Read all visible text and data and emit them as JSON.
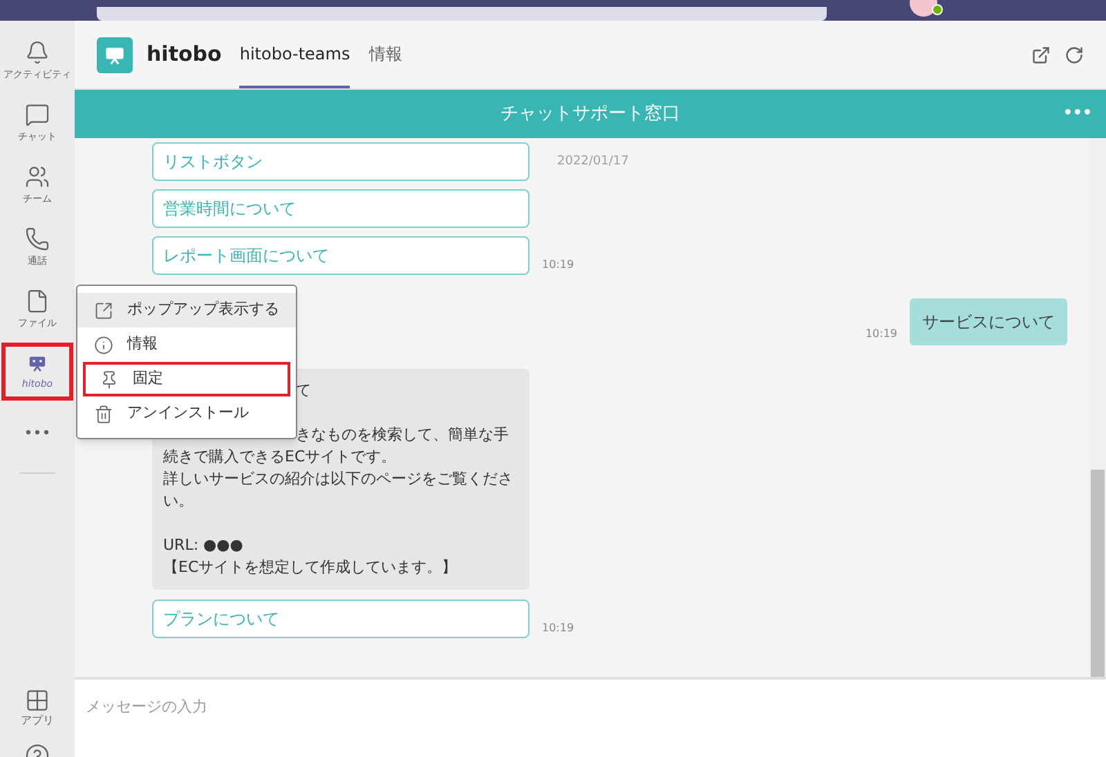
{
  "rail": {
    "items": [
      {
        "kind": "bell",
        "label": "アクティビティ",
        "selected": false,
        "highlighted": false
      },
      {
        "kind": "chat",
        "label": "チャット",
        "selected": false,
        "highlighted": false
      },
      {
        "kind": "team",
        "label": "チーム",
        "selected": false,
        "highlighted": false
      },
      {
        "kind": "call",
        "label": "通話",
        "selected": false,
        "highlighted": false
      },
      {
        "kind": "file",
        "label": "ファイル",
        "selected": false,
        "highlighted": false
      },
      {
        "kind": "bot",
        "label": "hitobo",
        "selected": true,
        "highlighted": true
      },
      {
        "kind": "more",
        "label": "•••",
        "selected": false,
        "highlighted": false
      }
    ],
    "bottom": [
      {
        "kind": "apps",
        "label": "アプリ"
      },
      {
        "kind": "help"
      }
    ]
  },
  "app_header": {
    "name": "hitobo",
    "tabs": [
      {
        "label": "hitobo-teams",
        "selected": true
      },
      {
        "label": "情報",
        "selected": false
      }
    ]
  },
  "chat_bar": {
    "title": "チャットサポート窓口",
    "more": "•••"
  },
  "messages": [
    {
      "kind": "buttons",
      "buttons": [
        "リストボタン",
        "営業時間について",
        "レポート画面について"
      ],
      "date": "2022/01/17",
      "time": "10:19"
    },
    {
      "kind": "user",
      "text": "サービスについて",
      "time": "10:19"
    },
    {
      "kind": "bot",
      "lines": [
        {
          "text": "て",
          "hidden_start": true
        },
        {
          "text": "きなものを検索して、簡単な手",
          "hidden_start": true
        },
        {
          "text": "続きで購入できるECサイトです。",
          "hidden_start": false
        },
        {
          "text": "詳しいサービスの紹介は以下のページをご覧ください。",
          "hidden_start": false
        },
        {
          "text": "URL: ●●●",
          "hidden_start": false
        },
        {
          "text": "【ECサイトを想定して作成しています。】",
          "hidden_start": false
        }
      ]
    },
    {
      "kind": "buttons",
      "buttons": [
        "プランについて"
      ],
      "time": "10:19"
    }
  ],
  "composer": {
    "placeholder": "メッセージの入力"
  },
  "context_menu": {
    "items": [
      {
        "kind": "popout",
        "label": "ポップアップ表示する",
        "selected": true,
        "highlighted": false
      },
      {
        "kind": "info",
        "label": "情報",
        "selected": false,
        "highlighted": false
      },
      {
        "kind": "pin",
        "label": "固定",
        "selected": false,
        "highlighted": true
      },
      {
        "kind": "trash",
        "label": "アンインストール",
        "selected": false,
        "highlighted": false
      }
    ]
  }
}
